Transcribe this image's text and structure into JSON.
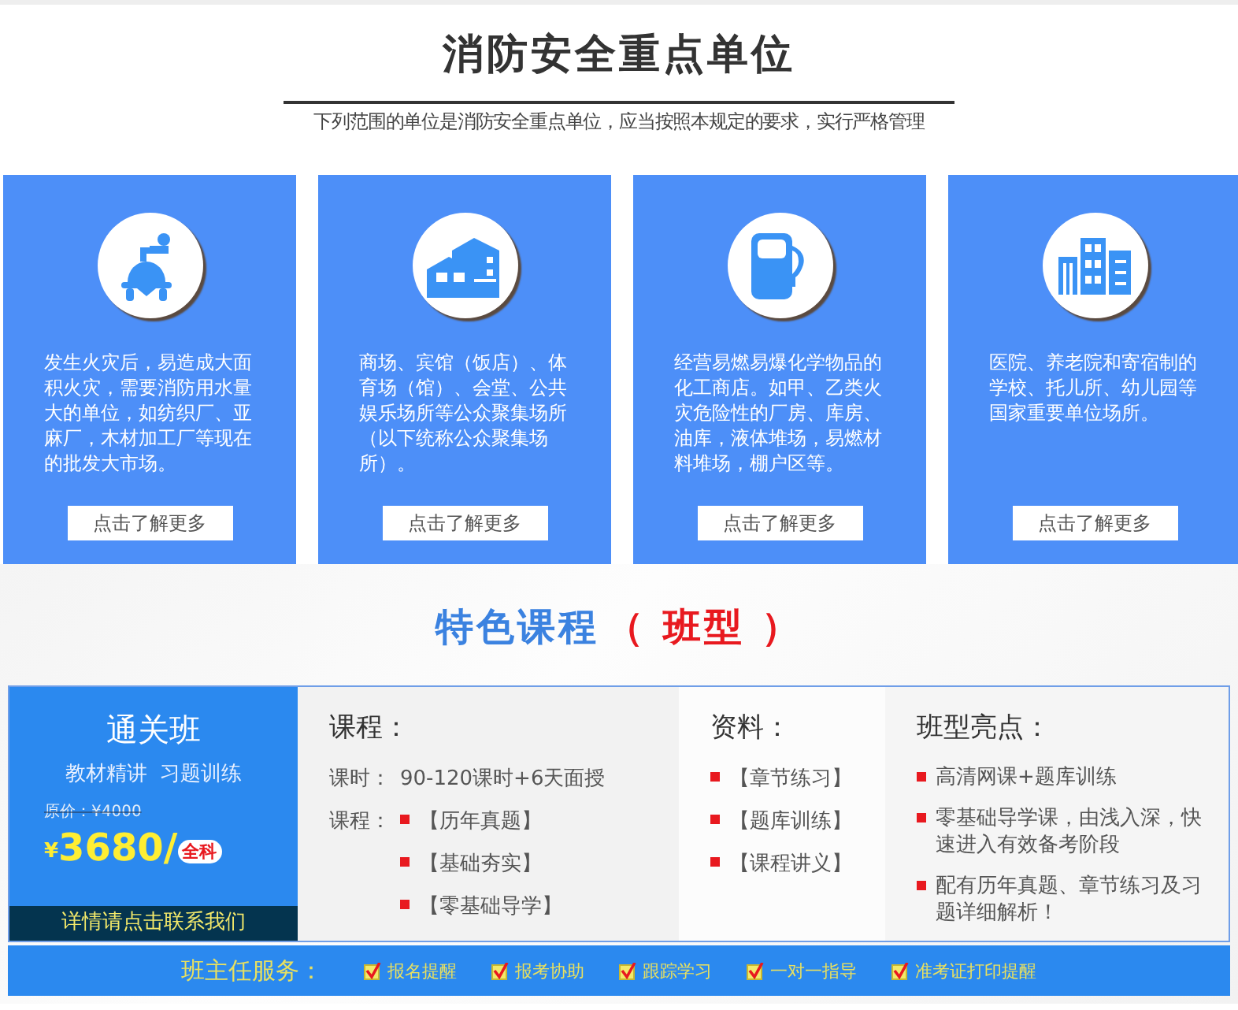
{
  "header": {
    "title": "消防安全重点单位",
    "subtitle": "下列范围的单位是消防安全重点单位，应当按照本规定的要求，实行严格管理"
  },
  "cards": [
    {
      "kind": "tank",
      "text": "发生火灾后，易造成大面积火灾，需要消防用水量大的单位，如纺织厂、亚麻厂，木材加工厂等现在的批发大市场。",
      "button": "点击了解更多"
    },
    {
      "kind": "houses",
      "text": "商场、宾馆（饭店）、体育场（馆）、会堂、公共娱乐场所等公众聚集场所（以下统称公众聚集场所）。",
      "button": "点击了解更多"
    },
    {
      "kind": "pump",
      "text": "经营易燃易爆化学物品的化工商店。如甲、乙类火灾危险性的厂房、库房、油库，液体堆场，易燃材料堆场，棚户区等。",
      "button": "点击了解更多"
    },
    {
      "kind": "buildings",
      "text": "医院、养老院和寄宿制的学校、托儿所、幼儿园等国家重要单位场所。",
      "button": "点击了解更多"
    }
  ],
  "courses": {
    "title": "特色课程",
    "title_accent": "（ 班型 ）",
    "class": {
      "name": "通关班",
      "tagline": "教材精讲  习题训练",
      "original_price": "原价：¥4000",
      "currency": "¥",
      "price": "3680/",
      "badge": "全科",
      "contact": "详情请点击联系我们"
    },
    "course": {
      "heading": "课程：",
      "hours_label": "课时：",
      "hours": "90-120课时+6天面授",
      "list_label": "课程：",
      "items": [
        "【历年真题】",
        "【基础夯实】",
        "【零基础导学】"
      ]
    },
    "materials": {
      "heading": "资料：",
      "items": [
        "【章节练习】",
        "【题库训练】",
        "【课程讲义】"
      ]
    },
    "highlights": {
      "heading": "班型亮点：",
      "items": [
        "高清网课+题库训练",
        "零基础导学课，由浅入深，快速进入有效备考阶段",
        "配有历年真题、章节练习及习题详细解析！"
      ]
    },
    "services": {
      "label": "班主任服务：",
      "items": [
        {
          "text": "报名提醒",
          "checked": true
        },
        {
          "text": "报考协助",
          "checked": true
        },
        {
          "text": "跟踪学习",
          "checked": true
        },
        {
          "text": "一对一指导",
          "checked": true
        },
        {
          "text": "准考证打印提醒",
          "checked": true
        }
      ]
    }
  }
}
